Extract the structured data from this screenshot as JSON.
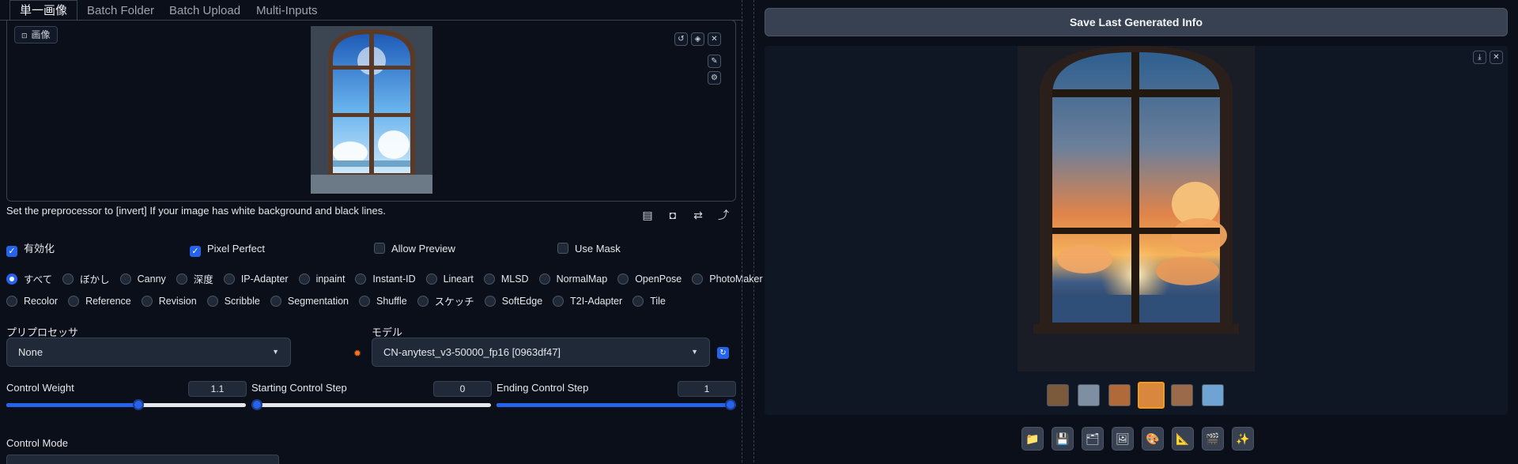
{
  "tabs": [
    "単一画像",
    "Batch Folder",
    "Batch Upload",
    "Multi-Inputs"
  ],
  "image_panel": {
    "label": "画像"
  },
  "hint": "Set the preprocessor to [invert] If your image has white background and black lines.",
  "checkboxes": [
    {
      "label": "有効化",
      "checked": true
    },
    {
      "label": "Pixel Perfect",
      "checked": true
    },
    {
      "label": "Allow Preview",
      "checked": false
    },
    {
      "label": "Use Mask",
      "checked": false
    }
  ],
  "control_types_row1": [
    "すべて",
    "ぼかし",
    "Canny",
    "深度",
    "IP-Adapter",
    "inpaint",
    "Instant-ID",
    "Lineart",
    "MLSD",
    "NormalMap",
    "OpenPose",
    "PhotoMaker"
  ],
  "control_types_row2": [
    "Recolor",
    "Reference",
    "Revision",
    "Scribble",
    "Segmentation",
    "Shuffle",
    "スケッチ",
    "SoftEdge",
    "T2I-Adapter",
    "Tile"
  ],
  "selected_control_type": "すべて",
  "preprocessor": {
    "label": "プリプロセッサ",
    "value": "None"
  },
  "model": {
    "label": "モデル",
    "value": "CN-anytest_v3-50000_fp16 [0963df47]"
  },
  "sliders": [
    {
      "label": "Control Weight",
      "value": "1.1",
      "fraction": 0.55
    },
    {
      "label": "Starting Control Step",
      "value": "0",
      "fraction": 0.0
    },
    {
      "label": "Ending Control Step",
      "value": "1",
      "fraction": 1.0
    }
  ],
  "control_mode": {
    "label": "Control Mode"
  },
  "save_button": "Save Last Generated Info",
  "toolbar_icons": [
    "folder-icon",
    "save-icon",
    "zip-icon",
    "image-icon",
    "palette-icon",
    "ruler-icon",
    "film-icon",
    "sparkle-icon"
  ],
  "colors": {
    "accent": "#2563eb",
    "background": "#0b0f19",
    "selected_thumb": "#f59e0b"
  }
}
